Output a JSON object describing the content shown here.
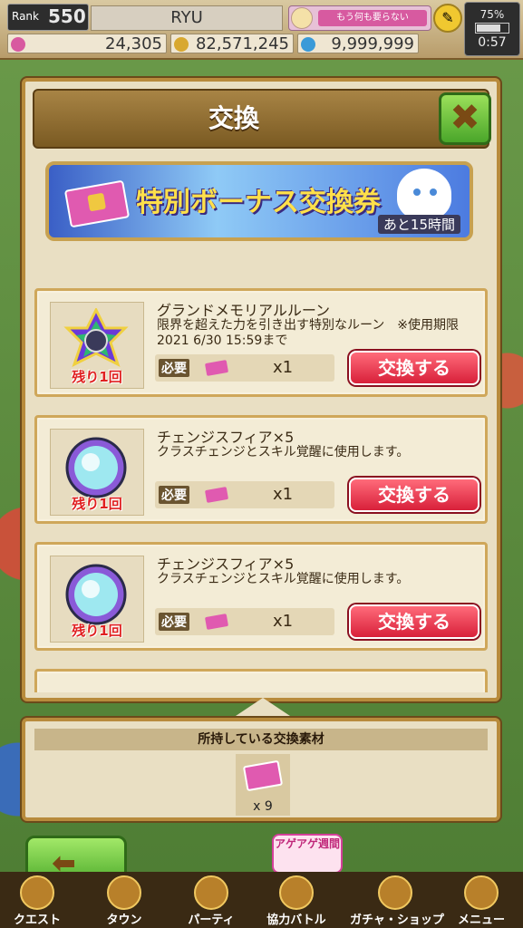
{
  "status": {
    "rank_label": "Rank",
    "rank_value": "550",
    "player_name": "RYU",
    "message": "もう何も要らない",
    "battery": "75%",
    "time": "0:57"
  },
  "currency": {
    "gems": "24,305",
    "gold": "82,571,245",
    "stamina": "9,999,999"
  },
  "modal": {
    "title": "交換",
    "close_glyph": "✖",
    "banner_title": "特別ボーナス交換券",
    "banner_timer": "あと15時間"
  },
  "items": [
    {
      "name": "グランドメモリアルルーン",
      "desc": "限界を超えた力を引き出す特別なルーン　※使用期限 2021 6/30 15:59まで",
      "remaining": "残り1回",
      "req_label": "必要",
      "qty": "x1",
      "button": "交換する"
    },
    {
      "name": "チェンジスフィア×5",
      "desc": "クラスチェンジとスキル覚醒に使用します。",
      "remaining": "残り1回",
      "req_label": "必要",
      "qty": "x1",
      "button": "交換する"
    },
    {
      "name": "チェンジスフィア×5",
      "desc": "クラスチェンジとスキル覚醒に使用します。",
      "remaining": "残り1回",
      "req_label": "必要",
      "qty": "x1",
      "button": "交換する"
    }
  ],
  "owned": {
    "header": "所持している交換素材",
    "count": "x 9"
  },
  "event_badge": "アゲアゲ週間",
  "nav": {
    "back_glyph": "⬅",
    "items": [
      "クエスト",
      "タウン",
      "パーティ",
      "協力バトル",
      "ガチャ・ショップ",
      "メニュー"
    ]
  },
  "colors": {
    "accent_red": "#d8203a",
    "accent_green": "#4caa2a",
    "frame_gold": "#b88b3c"
  }
}
